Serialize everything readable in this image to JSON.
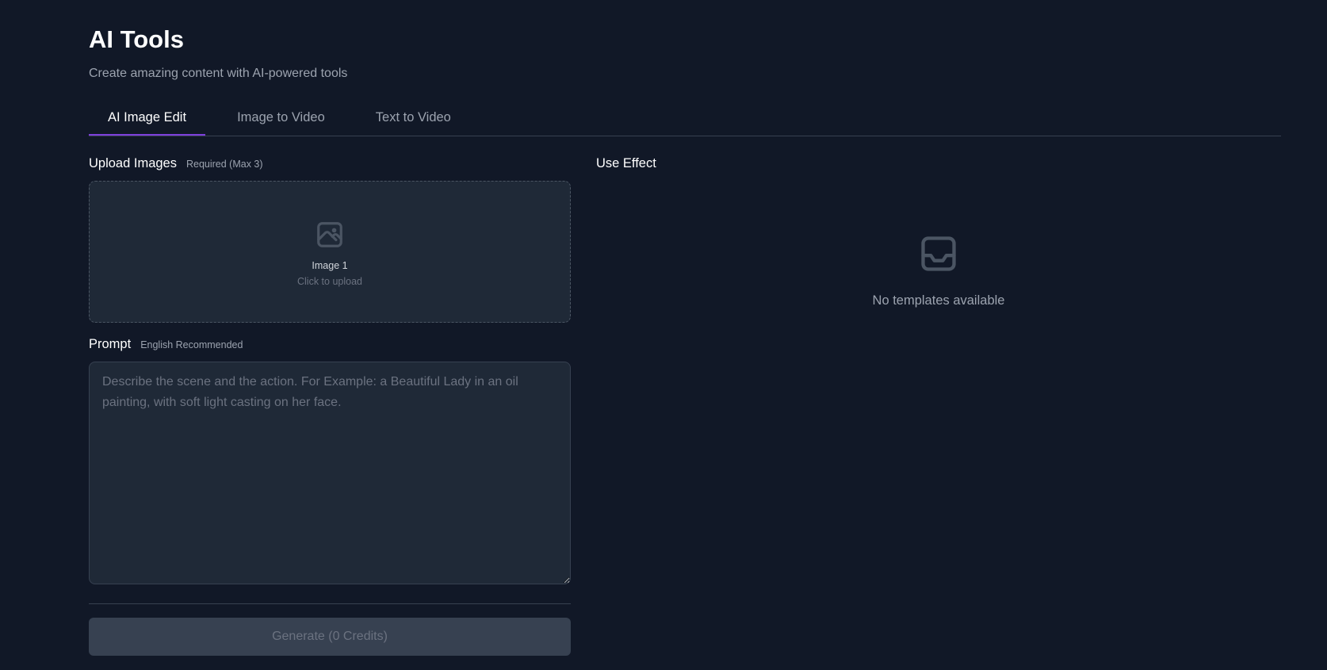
{
  "header": {
    "title": "AI Tools",
    "subtitle": "Create amazing content with AI-powered tools"
  },
  "tabs": [
    {
      "label": "AI Image Edit",
      "active": true
    },
    {
      "label": "Image to Video",
      "active": false
    },
    {
      "label": "Text to Video",
      "active": false
    }
  ],
  "upload": {
    "label": "Upload Images",
    "hint": "Required (Max 3)",
    "slot_title": "Image 1",
    "slot_sub": "Click to upload",
    "icon": "image-icon"
  },
  "prompt": {
    "label": "Prompt",
    "hint": "English Recommended",
    "value": "",
    "placeholder": "Describe the scene and the action. For Example: a Beautiful Lady in an oil painting, with soft light casting on her face."
  },
  "generate": {
    "label": "Generate (0 Credits)"
  },
  "effect": {
    "label": "Use Effect",
    "empty_text": "No templates available",
    "icon": "inbox-icon"
  },
  "colors": {
    "background": "#111827",
    "panel": "#1f2937",
    "accent": "#7e3fdc",
    "muted_text": "#9ca3af"
  }
}
